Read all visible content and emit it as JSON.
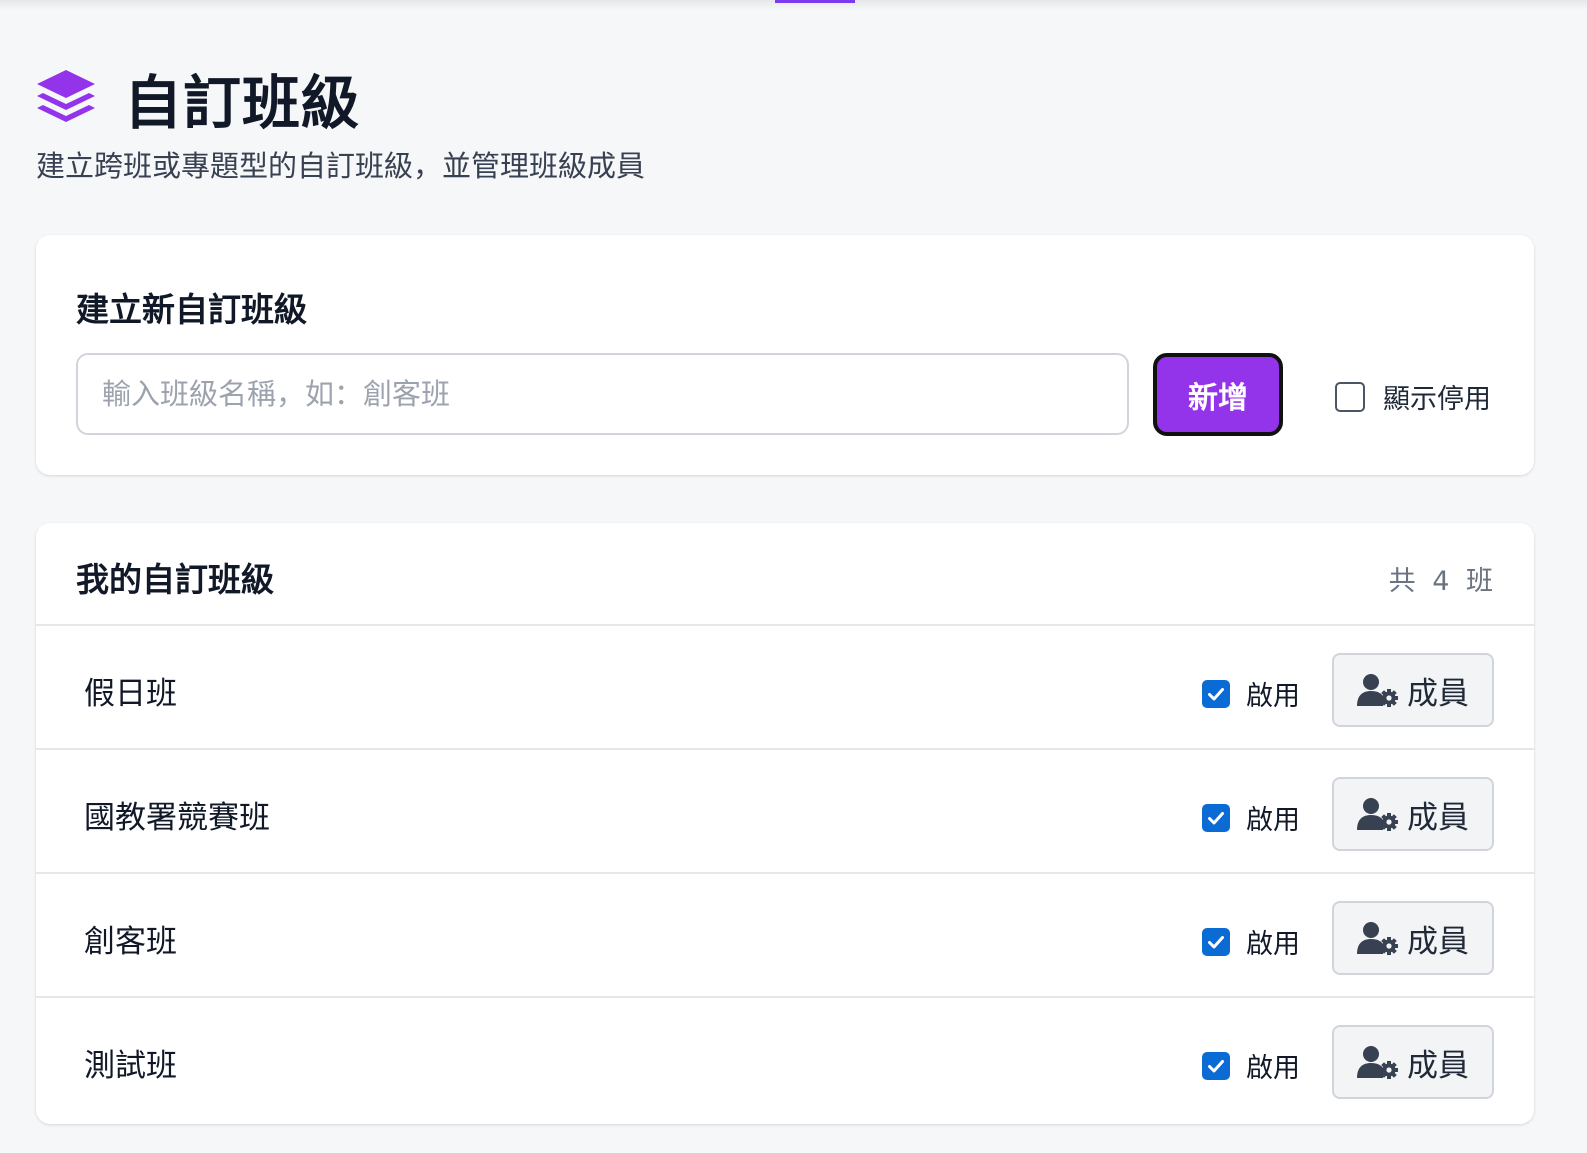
{
  "header": {
    "title": "自訂班級",
    "subtitle": "建立跨班或專題型的自訂班級，並管理班級成員",
    "logo_icon": "layers-icon",
    "accent_color": "#9333ea"
  },
  "create_card": {
    "title": "建立新自訂班級",
    "input_placeholder": "輸入班級名稱，如：創客班",
    "input_value": "",
    "add_button_label": "新增",
    "show_disabled_label": "顯示停用",
    "show_disabled_checked": false
  },
  "list_card": {
    "title": "我的自訂班級",
    "count_prefix": "共",
    "count": "4",
    "count_suffix": "班",
    "rows": [
      {
        "name": "假日班",
        "enabled_label": "啟用",
        "enabled": true,
        "members_label": "成員",
        "members_icon": "user-gear-icon"
      },
      {
        "name": "國教署競賽班",
        "enabled_label": "啟用",
        "enabled": true,
        "members_label": "成員",
        "members_icon": "user-gear-icon"
      },
      {
        "name": "創客班",
        "enabled_label": "啟用",
        "enabled": true,
        "members_label": "成員",
        "members_icon": "user-gear-icon"
      },
      {
        "name": "測試班",
        "enabled_label": "啟用",
        "enabled": true,
        "members_label": "成員",
        "members_icon": "user-gear-icon"
      }
    ]
  },
  "colors": {
    "primary": "#9333ea",
    "checkbox": "#0b6bd4",
    "background": "#f6f7f9"
  }
}
